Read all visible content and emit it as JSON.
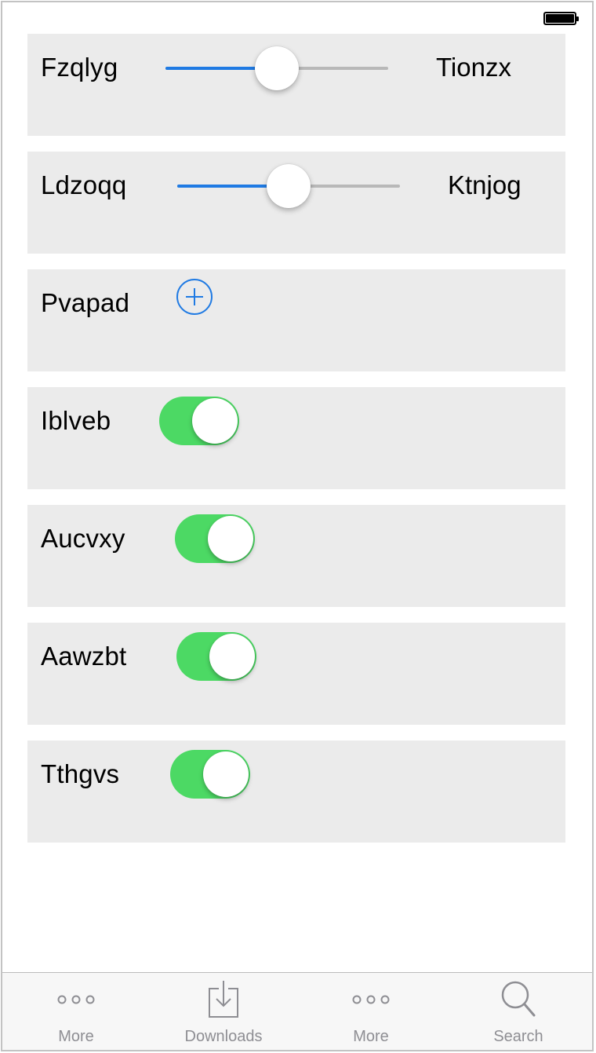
{
  "status_bar": {
    "battery_icon": "battery-full-icon"
  },
  "sliders": [
    {
      "label": "Fzqlyg",
      "end_label": "Tionzx",
      "value": 0.5
    },
    {
      "label": "Ldzoqq",
      "end_label": "Ktnjog",
      "value": 0.5
    }
  ],
  "add_row": {
    "label": "Pvapad",
    "icon": "plus-circle-icon"
  },
  "toggles": [
    {
      "label": "Iblveb",
      "on": true
    },
    {
      "label": "Aucvxy",
      "on": true
    },
    {
      "label": "Aawzbt",
      "on": true
    },
    {
      "label": "Tthgvs",
      "on": true
    }
  ],
  "tab_bar": {
    "items": [
      {
        "label": "More",
        "icon": "more-icon"
      },
      {
        "label": "Downloads",
        "icon": "downloads-icon"
      },
      {
        "label": "More",
        "icon": "more-icon"
      },
      {
        "label": "Search",
        "icon": "search-icon"
      }
    ]
  },
  "colors": {
    "accent_blue": "#1f7ae3",
    "toggle_on_green": "#4cd964",
    "row_background": "#ebebeb",
    "tab_label_gray": "#8e8e93"
  }
}
